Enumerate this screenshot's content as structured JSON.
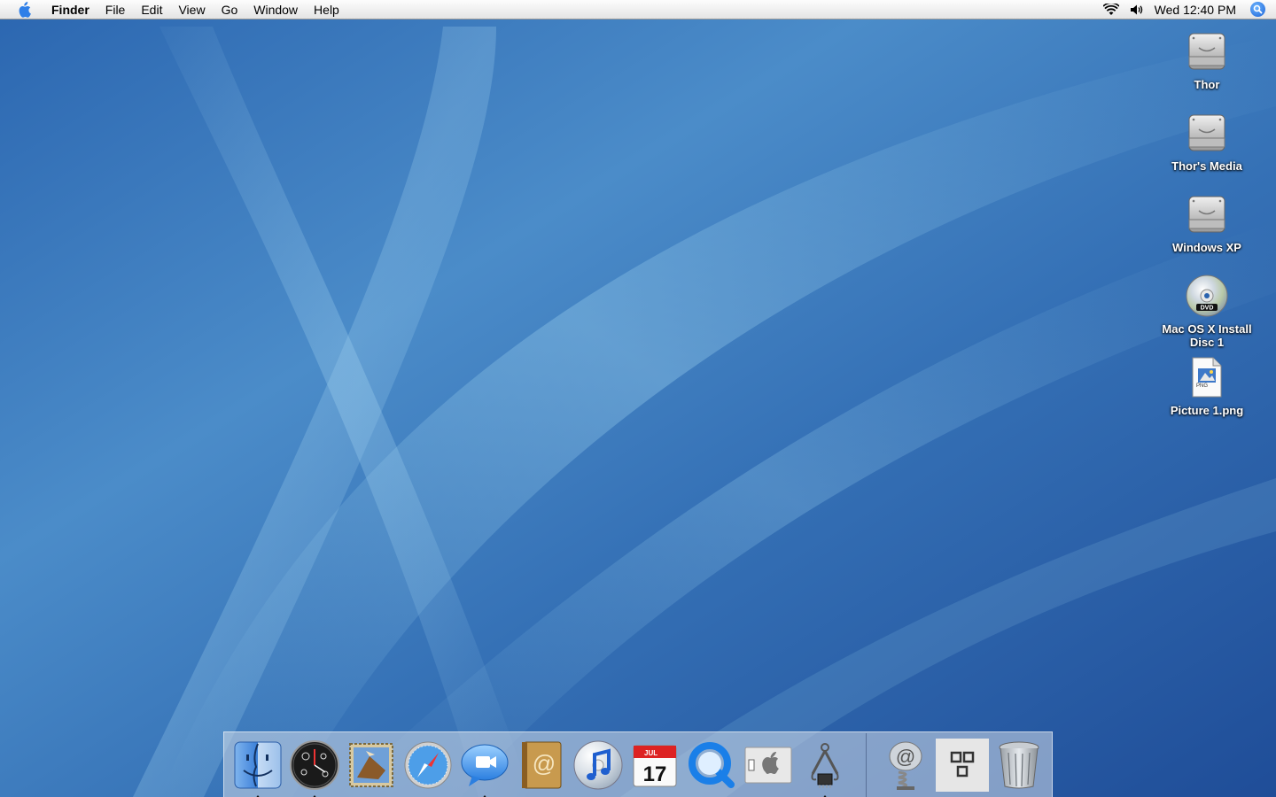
{
  "menubar": {
    "apple_icon": "apple-logo",
    "app_name": "Finder",
    "menus": [
      "File",
      "Edit",
      "View",
      "Go",
      "Window",
      "Help"
    ],
    "status_icons": [
      "wifi-icon",
      "volume-icon"
    ],
    "clock": "Wed 12:40 PM",
    "spotlight_icon": "spotlight-icon"
  },
  "desktop_icons": [
    {
      "label": "Thor",
      "icon": "hard-drive-icon"
    },
    {
      "label": "Thor's Media",
      "icon": "hard-drive-icon"
    },
    {
      "label": "Windows XP",
      "icon": "hard-drive-icon"
    },
    {
      "label": "Mac OS X Install Disc 1",
      "icon": "dvd-icon"
    },
    {
      "label": "Picture 1.png",
      "icon": "png-file-icon",
      "badge": "PNG"
    }
  ],
  "dock": {
    "apps": [
      {
        "name": "finder-icon",
        "running": true
      },
      {
        "name": "dashboard-icon",
        "running": true
      },
      {
        "name": "mail-icon",
        "running": false
      },
      {
        "name": "safari-icon",
        "running": false
      },
      {
        "name": "ichat-icon",
        "running": true
      },
      {
        "name": "address-book-icon",
        "running": false
      },
      {
        "name": "itunes-icon",
        "running": false
      },
      {
        "name": "ical-icon",
        "running": false,
        "month": "JUL",
        "day": "17"
      },
      {
        "name": "quicktime-icon",
        "running": false
      },
      {
        "name": "system-preferences-icon",
        "running": false
      },
      {
        "name": "system-profiler-icon",
        "running": true
      }
    ],
    "others": [
      {
        "name": "url-spring-icon"
      },
      {
        "name": "minimized-window-icon"
      },
      {
        "name": "trash-icon"
      }
    ]
  },
  "colors": {
    "wallpaper_base": "#2a62ae",
    "wallpaper_light": "#6ea8d8",
    "menubar": "#f2f2f2",
    "dock": "#d2dae8"
  }
}
